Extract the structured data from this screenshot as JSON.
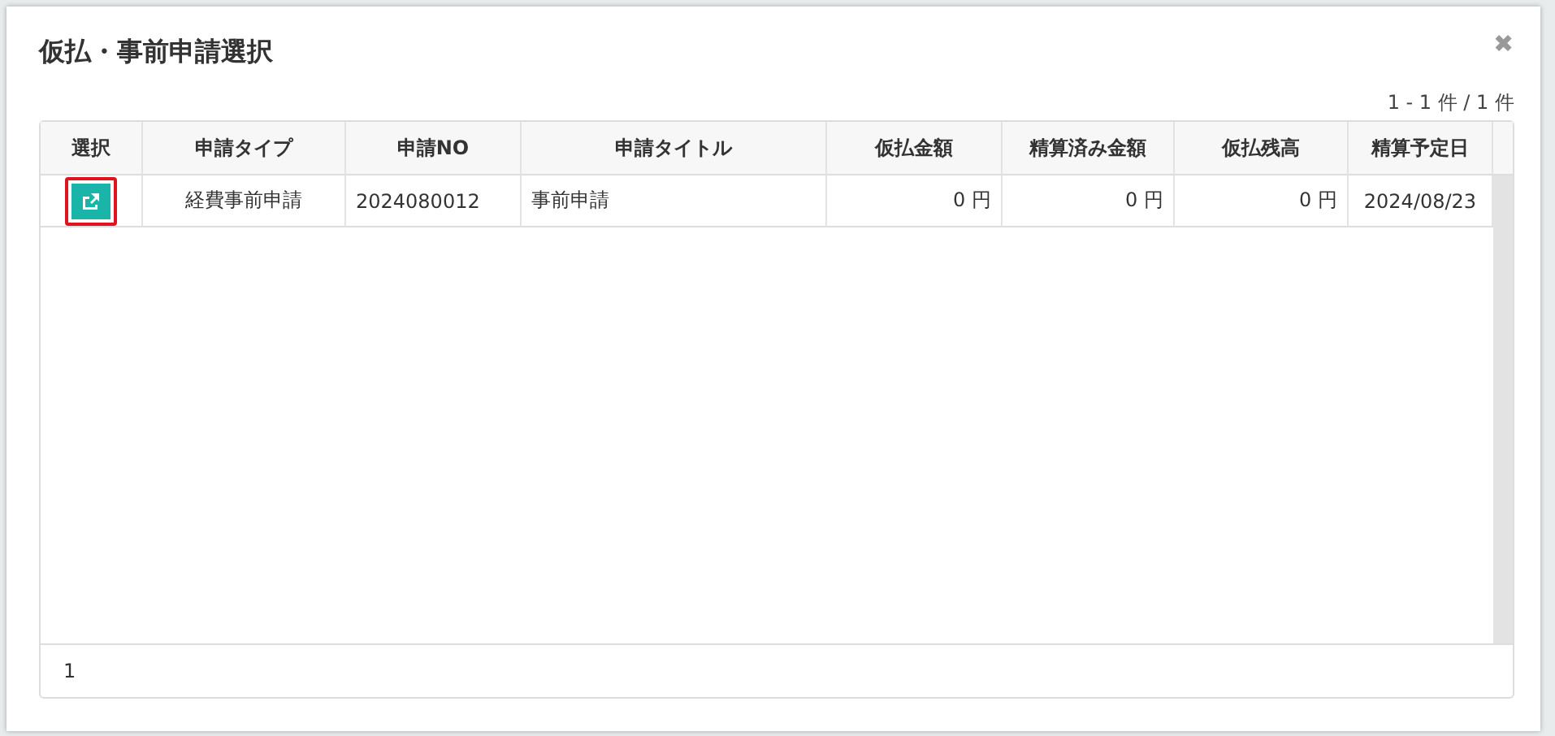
{
  "dialog": {
    "title": "仮払・事前申請選択",
    "close": "✖",
    "count": "1 - 1 件 / 1 件",
    "table": {
      "columns": [
        "選択",
        "申請タイプ",
        "申請NO",
        "申請タイトル",
        "仮払金額",
        "精算済み金額",
        "仮払残高",
        "精算予定日"
      ],
      "rows": [
        {
          "highlighted": true,
          "cells": [
            "",
            "経費事前申請",
            "2024080012",
            "事前申請",
            "0 円",
            "0 円",
            "0 円",
            "2024/08/23"
          ]
        }
      ]
    },
    "pagination": [
      "1"
    ]
  }
}
